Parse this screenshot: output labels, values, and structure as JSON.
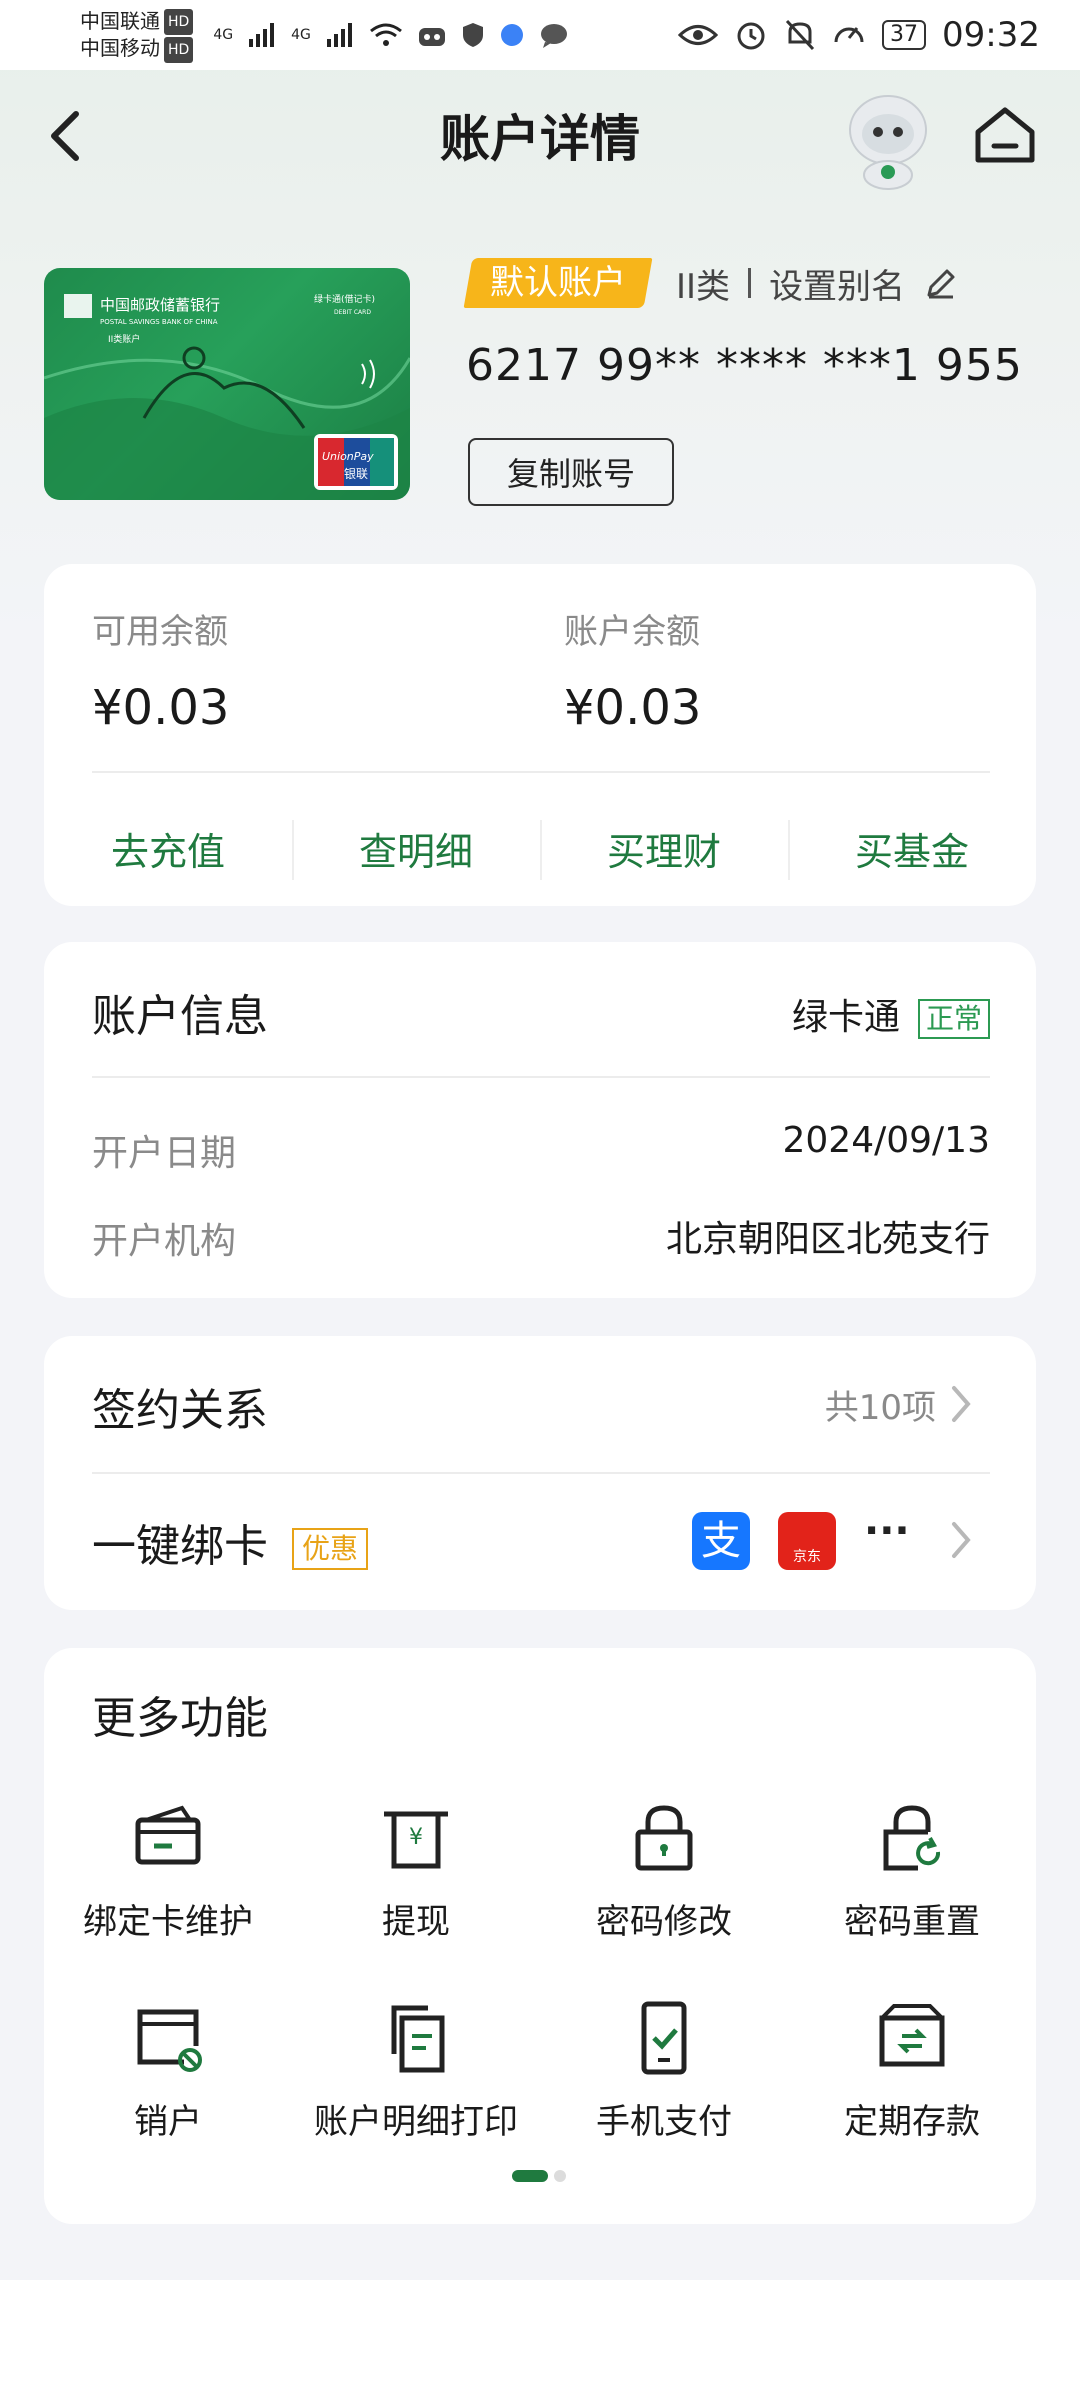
{
  "status_bar": {
    "carrier1": "中国联通",
    "carrier2": "中国移动",
    "hd": "HD",
    "battery": "37",
    "time": "09:32",
    "net1": "4G",
    "net2": "4G"
  },
  "header": {
    "title": "账户详情"
  },
  "card": {
    "default_tag": "默认账户",
    "class": "II类",
    "alias": "设置别名",
    "number": "6217 99** **** ***1 955",
    "copy_label": "复制账号",
    "bank_name_cn": "中国邮政储蓄银行",
    "bank_name_en": "POSTAL SAVINGS BANK OF CHINA",
    "card_type": "绿卡通(借记卡)",
    "card_type_en": "DEBIT CARD",
    "account_class": "II类账户",
    "unionpay": "UnionPay",
    "unionpay_cn": "银联"
  },
  "balance": {
    "available_label": "可用余额",
    "available_value": "¥0.03",
    "account_label": "账户余额",
    "account_value": "¥0.03",
    "actions": [
      "去充值",
      "查明细",
      "买理财",
      "买基金"
    ]
  },
  "account_info": {
    "title": "账户信息",
    "card_type": "绿卡通",
    "status": "正常",
    "open_date_label": "开户日期",
    "open_date": "2024/09/13",
    "branch_label": "开户机构",
    "branch": "北京朝阳区北苑支行"
  },
  "sign": {
    "title": "签约关系",
    "count": "共10项",
    "bind_title": "一键绑卡",
    "promo": "优惠",
    "alipay": "支",
    "jd": "京东",
    "more": "···"
  },
  "more": {
    "title": "更多功能",
    "features": [
      {
        "label": "绑定卡维护",
        "icon": "card-icon"
      },
      {
        "label": "提现",
        "icon": "withdraw-icon"
      },
      {
        "label": "密码修改",
        "icon": "lock-icon"
      },
      {
        "label": "密码重置",
        "icon": "lock-reset-icon"
      },
      {
        "label": "销户",
        "icon": "close-account-icon"
      },
      {
        "label": "账户明细打印",
        "icon": "print-icon"
      },
      {
        "label": "手机支付",
        "icon": "phone-pay-icon"
      },
      {
        "label": "定期存款",
        "icon": "deposit-icon"
      }
    ]
  },
  "colors": {
    "accent": "#1f7a3f",
    "tag": "#f7b51a",
    "promo": "#e8a317"
  }
}
